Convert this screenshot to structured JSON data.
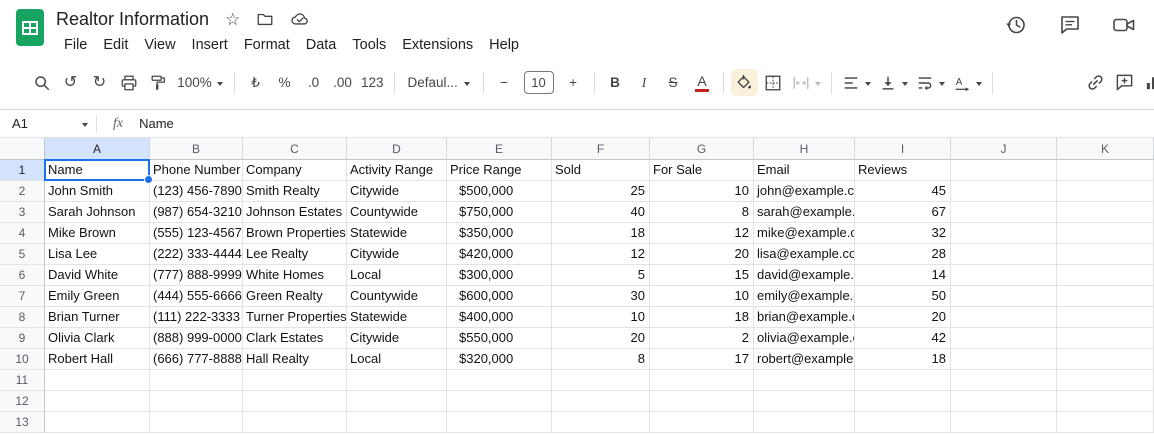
{
  "header": {
    "title": "Realtor Information",
    "menu_items": [
      "File",
      "Edit",
      "View",
      "Insert",
      "Format",
      "Data",
      "Tools",
      "Extensions",
      "Help"
    ]
  },
  "icons": {
    "undo_glyph": "↺",
    "redo_glyph": "↻",
    "star_glyph": "☆"
  },
  "colors": {
    "accent_blue": "#1a73e8",
    "logo_green": "#17a463",
    "text_color_red": "#c5221f",
    "selected_header_bg": "#d3e3fd"
  },
  "toolbar": {
    "zoom_value": "100%",
    "currency": "₺",
    "percent": "%",
    "decrease_decimal": ".0",
    "increase_decimal": ".00",
    "more_formats": "123",
    "font_name": "Defaul...",
    "decrease_font": "−",
    "font_size": "10",
    "increase_font": "+",
    "bold": "B",
    "italic": "I",
    "strikethrough": "S",
    "text_color": "A"
  },
  "formula_bar": {
    "cell_reference": "A1",
    "fx_label": "fx",
    "content": "Name"
  },
  "grid": {
    "column_letters": [
      "A",
      "B",
      "C",
      "D",
      "E",
      "F",
      "G",
      "H",
      "I",
      "J",
      "K"
    ],
    "row_numbers": [
      "1",
      "2",
      "3",
      "4",
      "5",
      "6",
      "7",
      "8",
      "9",
      "10",
      "11",
      "12",
      "13"
    ],
    "selected_cell": "A1"
  },
  "sheet": {
    "headers": [
      "Name",
      "Phone Number",
      "Company",
      "Activity Range",
      "Price Range",
      "Sold",
      "For Sale",
      "Email",
      "Reviews"
    ],
    "rows": [
      [
        "John Smith",
        "(123) 456-7890",
        "Smith Realty",
        "Citywide",
        "$500,000",
        "25",
        "10",
        "john@example.com",
        "45"
      ],
      [
        "Sarah Johnson",
        "(987) 654-3210",
        "Johnson Estates",
        "Countywide",
        "$750,000",
        "40",
        "8",
        "sarah@example.com",
        "67"
      ],
      [
        "Mike Brown",
        "(555) 123-4567",
        "Brown Properties",
        "Statewide",
        "$350,000",
        "18",
        "12",
        "mike@example.com",
        "32"
      ],
      [
        "Lisa Lee",
        "(222) 333-4444",
        "Lee Realty",
        "Citywide",
        "$420,000",
        "12",
        "20",
        "lisa@example.com",
        "28"
      ],
      [
        "David White",
        "(777) 888-9999",
        "White Homes",
        "Local",
        "$300,000",
        "5",
        "15",
        "david@example.com",
        "14"
      ],
      [
        "Emily Green",
        "(444) 555-6666",
        "Green Realty",
        "Countywide",
        "$600,000",
        "30",
        "10",
        "emily@example.com",
        "50"
      ],
      [
        "Brian Turner",
        "(111) 222-3333",
        "Turner Properties",
        "Statewide",
        "$400,000",
        "10",
        "18",
        "brian@example.com",
        "20"
      ],
      [
        "Olivia Clark",
        "(888) 999-0000",
        "Clark Estates",
        "Citywide",
        "$550,000",
        "20",
        "2",
        "olivia@example.com",
        "42"
      ],
      [
        "Robert Hall",
        "(666) 777-8888",
        "Hall Realty",
        "Local",
        "$320,000",
        "8",
        "17",
        "robert@example.com",
        "18"
      ]
    ]
  }
}
